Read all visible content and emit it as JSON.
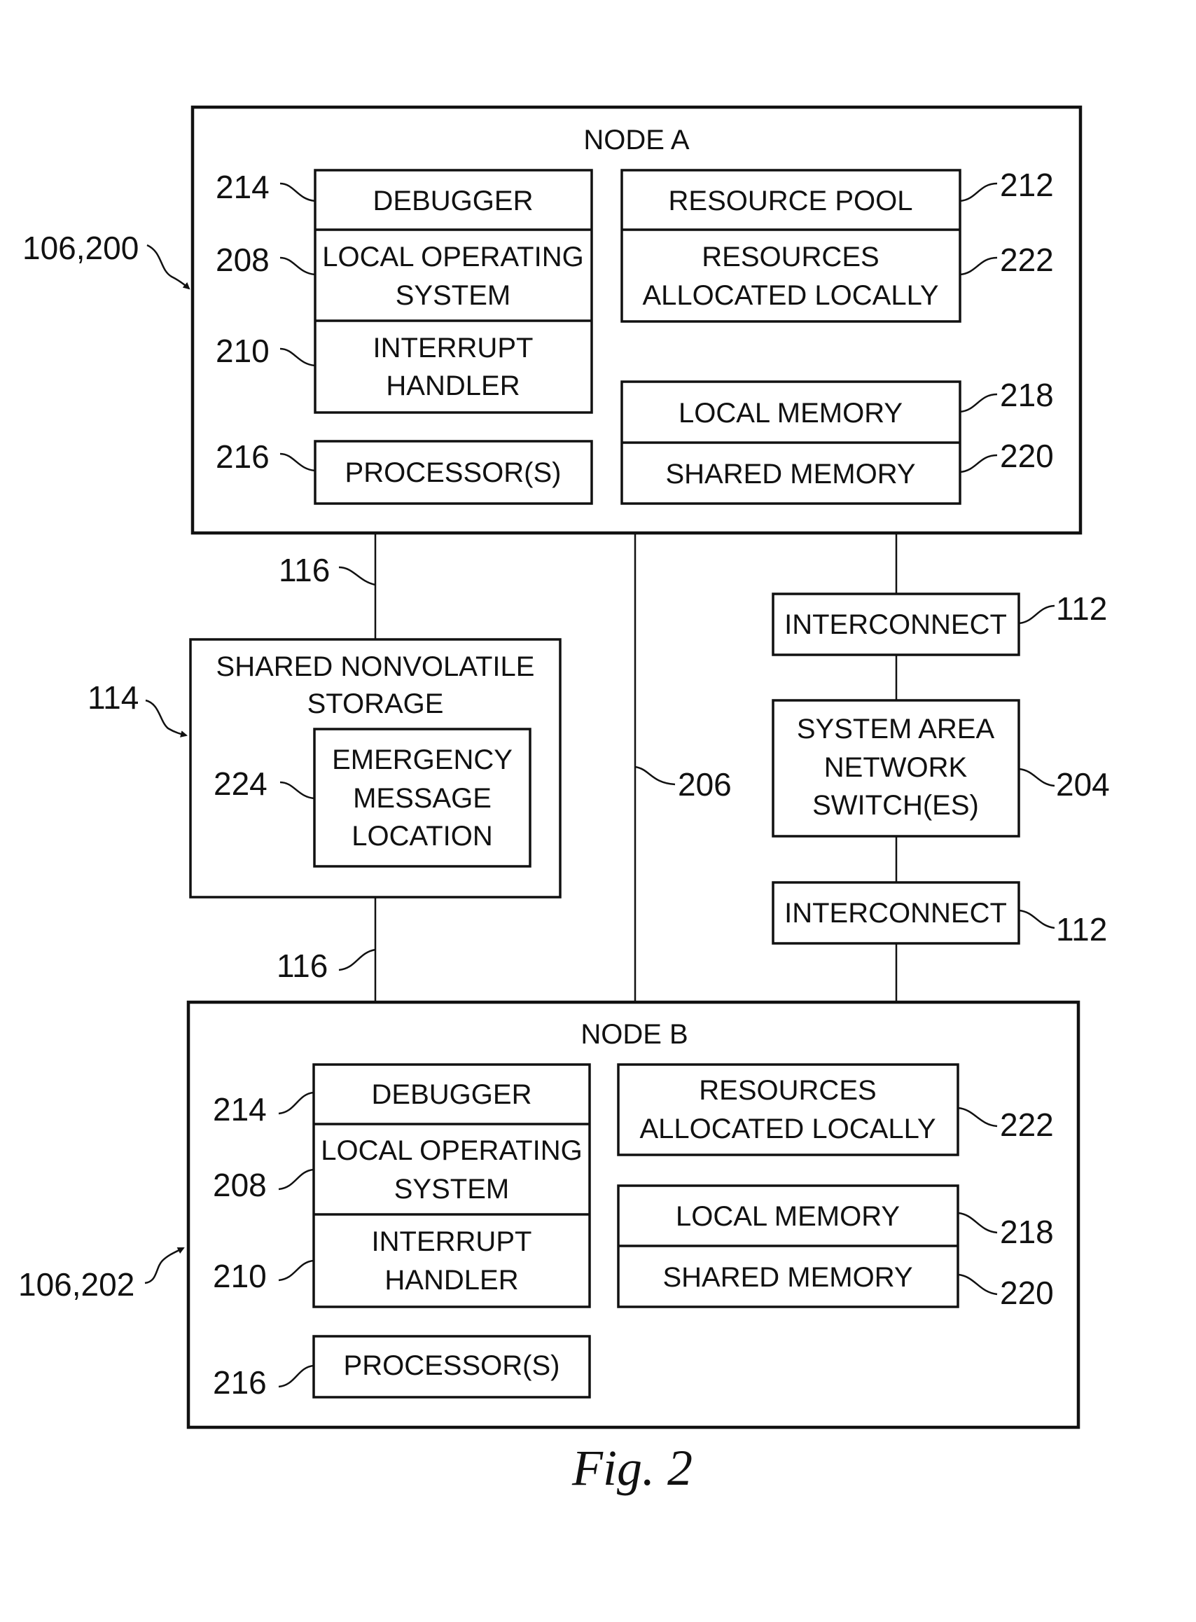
{
  "figure_caption": "Fig. 2",
  "node_a": {
    "title": "NODE A",
    "ref": "106,200",
    "left_stack": [
      {
        "ref": "214",
        "lines": [
          "DEBUGGER"
        ]
      },
      {
        "ref": "208",
        "lines": [
          "LOCAL OPERATING",
          "SYSTEM"
        ]
      },
      {
        "ref": "210",
        "lines": [
          "INTERRUPT",
          "HANDLER"
        ]
      }
    ],
    "processor": {
      "ref": "216",
      "lines": [
        "PROCESSOR(S)"
      ]
    },
    "resource_stack": [
      {
        "ref": "212",
        "lines": [
          "RESOURCE POOL"
        ]
      },
      {
        "ref": "222",
        "lines": [
          "RESOURCES",
          "ALLOCATED LOCALLY"
        ]
      }
    ],
    "memory_stack": [
      {
        "ref": "218",
        "lines": [
          "LOCAL MEMORY"
        ]
      },
      {
        "ref": "220",
        "lines": [
          "SHARED MEMORY"
        ]
      }
    ]
  },
  "shared_storage": {
    "ref": "114",
    "lines": [
      "SHARED NONVOLATILE",
      "STORAGE"
    ],
    "inner": {
      "ref": "224",
      "lines": [
        "EMERGENCY",
        "MESSAGE",
        "LOCATION"
      ]
    }
  },
  "links": {
    "storage_top_ref": "116",
    "storage_bottom_ref": "116",
    "direct_ref": "206"
  },
  "network": {
    "interconnect_top": {
      "ref": "112",
      "label": "INTERCONNECT"
    },
    "switch": {
      "ref": "204",
      "lines": [
        "SYSTEM AREA",
        "NETWORK",
        "SWITCH(ES)"
      ]
    },
    "interconnect_bottom": {
      "ref": "112",
      "label": "INTERCONNECT"
    }
  },
  "node_b": {
    "title": "NODE B",
    "ref": "106,202",
    "left_stack": [
      {
        "ref": "214",
        "lines": [
          "DEBUGGER"
        ]
      },
      {
        "ref": "208",
        "lines": [
          "LOCAL OPERATING",
          "SYSTEM"
        ]
      },
      {
        "ref": "210",
        "lines": [
          "INTERRUPT",
          "HANDLER"
        ]
      }
    ],
    "processor": {
      "ref": "216",
      "lines": [
        "PROCESSOR(S)"
      ]
    },
    "resources": {
      "ref": "222",
      "lines": [
        "RESOURCES",
        "ALLOCATED LOCALLY"
      ]
    },
    "memory_stack": [
      {
        "ref": "218",
        "lines": [
          "LOCAL MEMORY"
        ]
      },
      {
        "ref": "220",
        "lines": [
          "SHARED MEMORY"
        ]
      }
    ]
  }
}
